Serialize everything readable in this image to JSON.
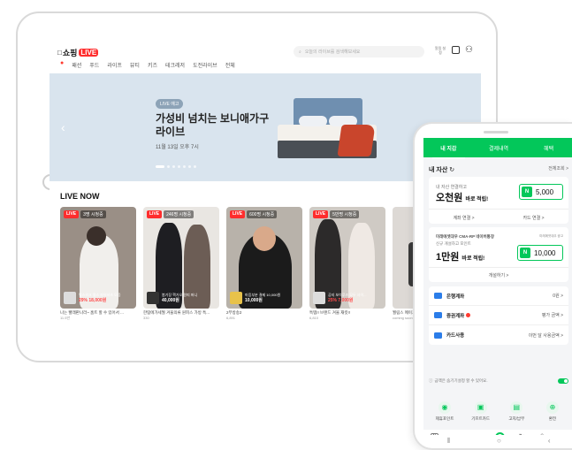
{
  "tablet": {
    "logo_text": "쇼핑",
    "logo_live": "LIVE",
    "nav": [
      "홈",
      "패션",
      "푸드",
      "라이프",
      "뷰티",
      "키즈",
      "테크레저",
      "도전라이브",
      "전체"
    ],
    "search_placeholder": "오늘의 라이브를 검색해보세요",
    "icon_label": "알림 설정",
    "banner": {
      "badge": "LIVE 예고",
      "title": "가성비 넘치는 보니애가구 라이브",
      "date": "11월 13일 오후 7시"
    },
    "live_now": "LIVE NOW",
    "cards": [
      {
        "live": "LIVE",
        "viewers": "3명 시청중",
        "product": "펄스워크 펄스 파워셔츠 모음",
        "price": "29% 18,000원",
        "caption": "나는 빨래판나라~ 홈트 할 수 있어서 ...",
        "views": "11.5만"
      },
      {
        "live": "LIVE",
        "viewers": "246명 시청중",
        "product": "봄기장 핵가오 원피 퍼니",
        "price": "40,000원",
        "caption": "한땀에가세월 겨울의류 원피스 가방 특...",
        "views": "330"
      },
      {
        "live": "LIVE",
        "viewers": "600명 시청중",
        "product": "마음부분 결제 10,000원",
        "price": "10,000원",
        "caption": "2부방송2",
        "views": "6,891"
      },
      {
        "live": "LIVE",
        "viewers": "5만명 시청중",
        "product": "공지 보석루즈 모두 사이...",
        "price": "25% 7,000원",
        "caption": "특템!! 브랜드 겨울 재킷!!",
        "views": "6,810"
      },
      {
        "live": "",
        "viewers": "",
        "product": "",
        "price": "",
        "caption": "월림스 메이크",
        "views": "coming soon"
      }
    ]
  },
  "phone": {
    "tabs": [
      "내 지갑",
      "결제내역",
      "혜택"
    ],
    "asset_title": "내 자산",
    "asset_more": "전체조회 >",
    "box1": {
      "sub": "내 자산 연결하고",
      "big": "오천원",
      "big_suffix": "바로 적립!",
      "amount": "5,000",
      "link1": "계좌 연결 >",
      "link2": "카드 연결 >"
    },
    "box2": {
      "sub": "미래에셋대우 CMA-RP 네이버통장",
      "tiny": "미래에셋대우 광고",
      "sub2": "신규 개설하고 포인트",
      "big": "1만원",
      "big_suffix": "바로 적립!",
      "amount": "10,000",
      "open": "개설하기 >"
    },
    "rows": [
      {
        "label": "은행계좌",
        "value": "0원 >",
        "color": "#2b7de9"
      },
      {
        "label": "증권계좌",
        "value": "평가 금액 >",
        "color": "#2b7de9"
      },
      {
        "label": "카드사용",
        "value": "이번 달 사용금액 >",
        "color": "#2b7de9"
      }
    ],
    "hide_text": "금액은 숨기기설정 할 수 있어요.",
    "quick": [
      "제휴포인트",
      "기프트카드",
      "고지/납부",
      "환전"
    ],
    "nbox": "N"
  }
}
